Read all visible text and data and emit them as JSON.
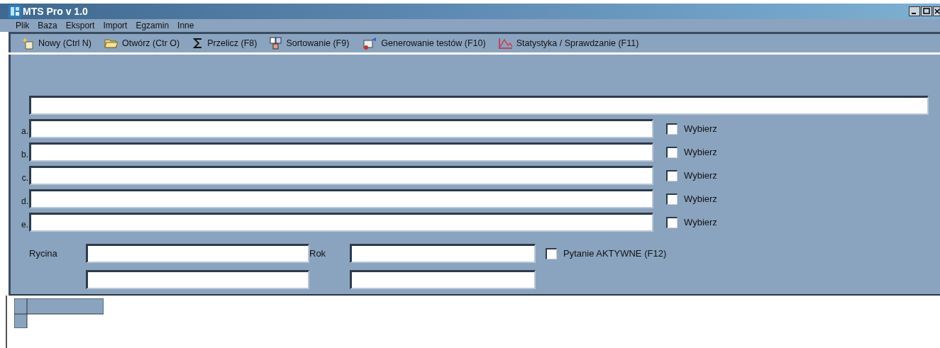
{
  "window": {
    "title": "MTS Pro v 1.0"
  },
  "menu": [
    "Plik",
    "Baza",
    "Eksport",
    "Import",
    "Egzamin",
    "Inne"
  ],
  "toolbar": [
    {
      "label": "Nowy (Ctrl N)"
    },
    {
      "label": "Otwórz (Ctr O)"
    },
    {
      "label": "Przelicz (F8)"
    },
    {
      "label": "Sortowanie (F9)"
    },
    {
      "label": "Generowanie testów (F10)"
    },
    {
      "label": "Statystyka / Sprawdzanie (F11)"
    }
  ],
  "answers": [
    {
      "letter": "a.",
      "option": "Wybierz",
      "checked": false
    },
    {
      "letter": "b.",
      "option": "Wybierz",
      "checked": false
    },
    {
      "letter": "c.",
      "option": "Wybierz",
      "checked": false
    },
    {
      "letter": "d.",
      "option": "Wybierz",
      "checked": false
    },
    {
      "letter": "e.",
      "option": "Wybierz",
      "checked": false
    }
  ],
  "figure_label": "Rycina",
  "year_label": "Rok",
  "active": {
    "label": "Pytanie AKTYWNE (F12)",
    "checked": false
  }
}
